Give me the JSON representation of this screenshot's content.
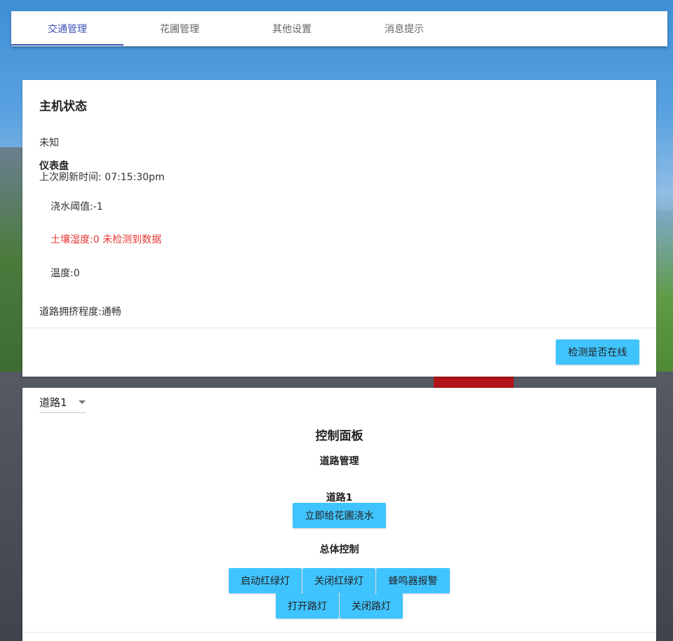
{
  "tabs": [
    {
      "label": "交通管理",
      "active": true
    },
    {
      "label": "花圃管理",
      "active": false
    },
    {
      "label": "其他设置",
      "active": false
    },
    {
      "label": "消息提示",
      "active": false
    }
  ],
  "status_card": {
    "title": "主机状态",
    "host_state": "未知",
    "dashboard_title": "仪表盘",
    "refresh_label": "上次刷新时间: ",
    "refresh_time": "07:15:30pm",
    "watering_threshold": "浇水阈值:-1",
    "soil_humidity": "土壤湿度:0 未检测到数据",
    "temperature": "温度:0",
    "road_congestion": "道路拥挤程度:通畅",
    "check_button": "检测是否在线"
  },
  "control_card": {
    "road_select": {
      "selected": "道路1"
    },
    "panel_title": "控制面板",
    "road_management": "道路管理",
    "road_name": "道路1",
    "water_button": "立即给花圃浇水",
    "overall_control": "总体控制",
    "buttons": {
      "start_lights": "启动红绿灯",
      "stop_lights": "关闭红绿灯",
      "buzzer_alarm": "蜂鸣器报警",
      "street_lights_on": "打开路灯",
      "street_lights_off": "关闭路灯"
    }
  },
  "colors": {
    "accent": "#3f51b5",
    "button": "#40c4ff",
    "alert": "#e53935"
  }
}
